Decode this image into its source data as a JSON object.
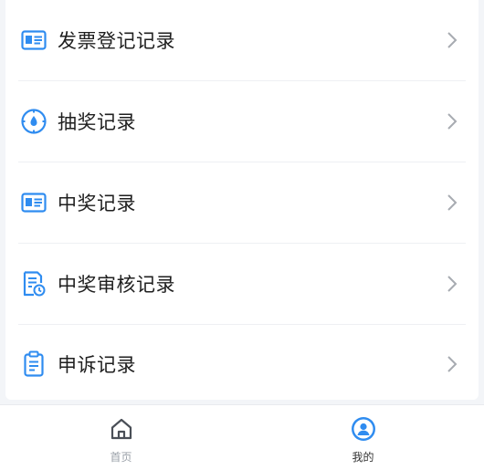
{
  "menu": {
    "items": [
      {
        "label": "发票登记记录",
        "icon": "invoice-card-icon"
      },
      {
        "label": "抽奖记录",
        "icon": "lottery-dial-icon"
      },
      {
        "label": "中奖记录",
        "icon": "winning-card-icon"
      },
      {
        "label": "中奖审核记录",
        "icon": "review-document-icon"
      },
      {
        "label": "申诉记录",
        "icon": "clipboard-icon"
      }
    ]
  },
  "tabbar": {
    "home_label": "首页",
    "mine_label": "我的",
    "active": "我的"
  },
  "colors": {
    "accent": "#2f8cf0",
    "inactive": "#9aa0a8",
    "chevron": "#a7abb1"
  }
}
